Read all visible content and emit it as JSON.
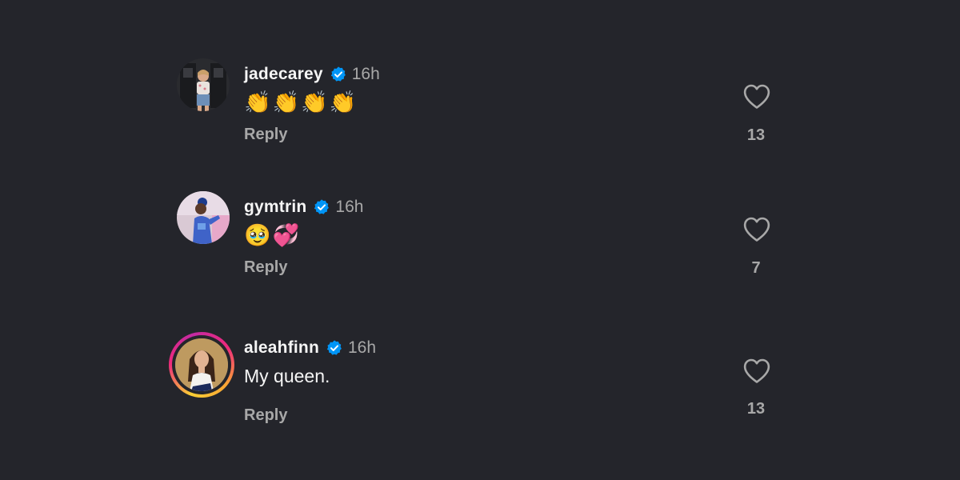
{
  "colors": {
    "background": "#24252b",
    "text_primary": "#f5f5f5",
    "text_secondary": "#a8a8a8",
    "verified_blue": "#0095f6"
  },
  "comments": [
    {
      "username": "jadecarey",
      "verified_icon": "verified-badge-icon",
      "time": "16h",
      "text": "👏👏👏👏",
      "reply_label": "Reply",
      "like_icon": "heart-outline-icon",
      "like_count": "13",
      "story_ring": false
    },
    {
      "username": "gymtrin",
      "verified_icon": "verified-badge-icon",
      "time": "16h",
      "text": "🥹💞",
      "reply_label": "Reply",
      "like_icon": "heart-outline-icon",
      "like_count": "7",
      "story_ring": false
    },
    {
      "username": "aleahfinn",
      "verified_icon": "verified-badge-icon",
      "time": "16h",
      "text": "My queen.",
      "reply_label": "Reply",
      "like_icon": "heart-outline-icon",
      "like_count": "13",
      "story_ring": true
    }
  ]
}
